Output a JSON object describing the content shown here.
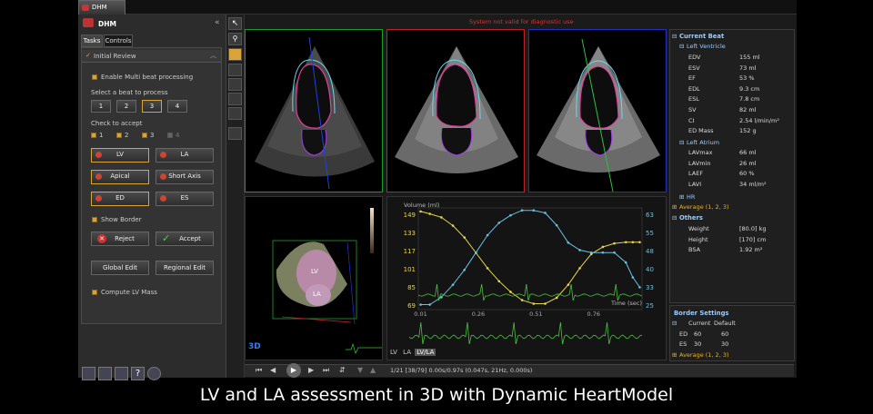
{
  "app_tab": "DHM",
  "warning": "System not valid for diagnostic use",
  "left_panel": {
    "title": "DHM",
    "tabs": [
      "Tasks",
      "Controls"
    ],
    "section": "Initial Review",
    "enable_multibeat": "Enable Multi beat processing",
    "select_beat_label": "Select a beat to process",
    "beats": [
      "1",
      "2",
      "3",
      "4"
    ],
    "check_accept_label": "Check to accept",
    "accept_checks": [
      "1",
      "2",
      "3",
      "4"
    ],
    "chamber_buttons": [
      "LV",
      "LA"
    ],
    "view_buttons": [
      "Apical",
      "Short Axis"
    ],
    "phase_buttons": [
      "ED",
      "ES"
    ],
    "show_border": "Show Border",
    "reject": "Reject",
    "accept": "Accept",
    "global_edit": "Global Edit",
    "regional_edit": "Regional Edit",
    "compute_lv_mass": "Compute LV Mass"
  },
  "model3d": {
    "lv_label": "LV",
    "la_label": "LA",
    "badge": "3D"
  },
  "chart_data": {
    "type": "line",
    "ylabel": "Volume (ml)",
    "xlabel": "Time (sec)",
    "x_ticks": [
      "0.01",
      "0.26",
      "0.51",
      "0.76"
    ],
    "y_left_ticks": [
      "149",
      "133",
      "117",
      "101",
      "85",
      "69"
    ],
    "y_right_ticks": [
      "63",
      "55",
      "48",
      "40",
      "33",
      "25"
    ],
    "xlim": [
      0,
      0.97
    ],
    "ylim_left": [
      69,
      155
    ],
    "ylim_right": [
      25,
      66
    ],
    "series": [
      {
        "color": "#e8d44a",
        "x": [
          0.01,
          0.05,
          0.1,
          0.15,
          0.2,
          0.25,
          0.3,
          0.35,
          0.4,
          0.45,
          0.5,
          0.55,
          0.6,
          0.65,
          0.7,
          0.75,
          0.8,
          0.85,
          0.9,
          0.93,
          0.96
        ],
        "values": [
          152,
          150,
          147,
          140,
          130,
          117,
          104,
          93,
          84,
          77,
          74,
          74,
          79,
          90,
          104,
          116,
          122,
          125,
          126,
          126,
          126
        ]
      },
      {
        "color": "#6ac0e0",
        "x": [
          0.01,
          0.05,
          0.1,
          0.15,
          0.2,
          0.25,
          0.3,
          0.35,
          0.4,
          0.45,
          0.5,
          0.55,
          0.6,
          0.65,
          0.7,
          0.75,
          0.8,
          0.85,
          0.9,
          0.93,
          0.96
        ],
        "values": [
          27,
          27,
          30,
          35,
          41,
          48,
          55,
          60,
          63,
          65,
          65,
          64,
          59,
          52,
          49,
          48,
          48,
          48,
          44,
          38,
          34
        ]
      }
    ],
    "ecg_color": "#4cc040"
  },
  "chart_view_buttons": [
    "LV",
    "LA",
    "LV/LA"
  ],
  "transport": {
    "frame": "1/21 [38/79] 0.00s/0.97s (0.047s, 21Hz, 0.000s)"
  },
  "right_panel": {
    "current_beat": "Current Beat",
    "left_ventricle": "Left Ventricle",
    "lv_rows": [
      {
        "k": "EDV",
        "v": "155 ml"
      },
      {
        "k": "ESV",
        "v": "73 ml"
      },
      {
        "k": "EF",
        "v": "53 %"
      },
      {
        "k": "EDL",
        "v": "9.3 cm"
      },
      {
        "k": "ESL",
        "v": "7.8 cm"
      },
      {
        "k": "SV",
        "v": "82 ml"
      },
      {
        "k": "CI",
        "v": "2.54 l/min/m²"
      },
      {
        "k": "ED Mass",
        "v": "152 g"
      }
    ],
    "left_atrium": "Left Atrium",
    "la_rows": [
      {
        "k": "LAVmax",
        "v": "66 ml"
      },
      {
        "k": "LAVmin",
        "v": "26 ml"
      },
      {
        "k": "LAEF",
        "v": "60 %"
      },
      {
        "k": "LAVI",
        "v": "34 ml/m²"
      }
    ],
    "hr": "HR",
    "average": "Average (1, 2, 3)",
    "others": "Others",
    "other_rows": [
      {
        "k": "Weight",
        "v": "[80.0] kg"
      },
      {
        "k": "Height",
        "v": "[170] cm"
      },
      {
        "k": "BSA",
        "v": "1.92 m²"
      }
    ]
  },
  "border_settings": {
    "title": "Border Settings",
    "col_current": "Current",
    "col_default": "Default",
    "rows": [
      {
        "k": "ED",
        "c": "60",
        "d": "60"
      },
      {
        "k": "ES",
        "c": "30",
        "d": "30"
      }
    ],
    "average": "Average (1, 2, 3)"
  },
  "caption": "LV and LA assessment in 3D with Dynamic HeartModel"
}
